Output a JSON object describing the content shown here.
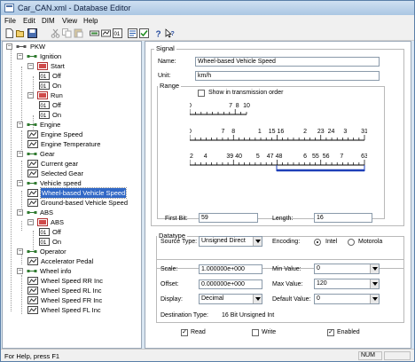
{
  "window": {
    "title": "Car_CAN.xml - Database Editor"
  },
  "menu": [
    "File",
    "Edit",
    "DIM",
    "View",
    "Help"
  ],
  "toolbar": {
    "icons": [
      "new-icon",
      "open-icon",
      "save-icon",
      "cut-icon",
      "copy-icon",
      "paste-icon",
      "add-message-icon",
      "add-signal-icon",
      "add-value-icon",
      "properties-icon",
      "check-icon",
      "help-icon",
      "context-help-icon"
    ]
  },
  "tree": {
    "root": "PKW",
    "nodes": [
      {
        "label": "Ignition"
      },
      {
        "label": "Start"
      },
      {
        "label": "Off"
      },
      {
        "label": "On"
      },
      {
        "label": "Run"
      },
      {
        "label": "Off"
      },
      {
        "label": "On"
      },
      {
        "label": "Engine"
      },
      {
        "label": "Engine Speed"
      },
      {
        "label": "Engine Temperature"
      },
      {
        "label": "Gear"
      },
      {
        "label": "Current gear"
      },
      {
        "label": "Selected Gear"
      },
      {
        "label": "Vehicle speed"
      },
      {
        "label": "Wheel-based Vehicle Speed"
      },
      {
        "label": "Ground-based Vehicle Speed"
      },
      {
        "label": "ABS"
      },
      {
        "label": "ABS"
      },
      {
        "label": "Off"
      },
      {
        "label": "On"
      },
      {
        "label": "Operator"
      },
      {
        "label": "Accelerator Pedal"
      },
      {
        "label": "Wheel info"
      },
      {
        "label": "Wheel Speed RR Inc"
      },
      {
        "label": "Wheel Speed RL Inc"
      },
      {
        "label": "Wheel Speed FR Inc"
      },
      {
        "label": "Wheel Speed FL Inc"
      }
    ]
  },
  "signal": {
    "group_title": "Signal",
    "name_label": "Name:",
    "name_value": "Wheel-based Vehicle Speed",
    "unit_label": "Unit:",
    "unit_value": "km/h",
    "range_title": "Range",
    "show_in_transmission_order": "Show in transmission order",
    "first_bit_label": "First Bit:",
    "first_bit_value": "59",
    "length_label": "Length:",
    "length_value": "16"
  },
  "ruler1": [
    "0",
    "7",
    "8",
    "10"
  ],
  "ruler2": [
    "0",
    "7",
    "8",
    "1",
    "15",
    "16",
    "2",
    "23",
    "24",
    "3",
    "31"
  ],
  "ruler3": [
    "32",
    "4",
    "39",
    "40",
    "5",
    "47",
    "48",
    "6",
    "55",
    "56",
    "7",
    "63"
  ],
  "datatype": {
    "group_title": "Datatype",
    "source_type_label": "Source Type:",
    "source_type_value": "Unsigned Direct",
    "encoding_label": "Encoding:",
    "intel_label": "Intel",
    "motorola_label": "Motorola",
    "encoding_selected": "Intel"
  },
  "scaling": {
    "scale_label": "Scale:",
    "scale_value": "1.000000e+000",
    "offset_label": "Offset:",
    "offset_value": "0.000000e+000",
    "display_label": "Display:",
    "display_value": "Decimal",
    "min_label": "Min Value:",
    "min_value": "0",
    "max_label": "Max Value:",
    "max_value": "120",
    "default_label": "Default Value:",
    "default_value": "0",
    "destination_label": "Destination Type:",
    "destination_value": "16 Bit Unsigned Int"
  },
  "access": {
    "read_label": "Read",
    "read_checked": true,
    "write_label": "Write",
    "write_checked": false,
    "enabled_label": "Enabled",
    "enabled_checked": true
  },
  "status": {
    "text": "For Help, press F1",
    "num": "NUM"
  },
  "colors": {
    "selection": "#3168c6",
    "bit_range": "#1e3fb8",
    "window_frame": "#d9e6f2"
  }
}
